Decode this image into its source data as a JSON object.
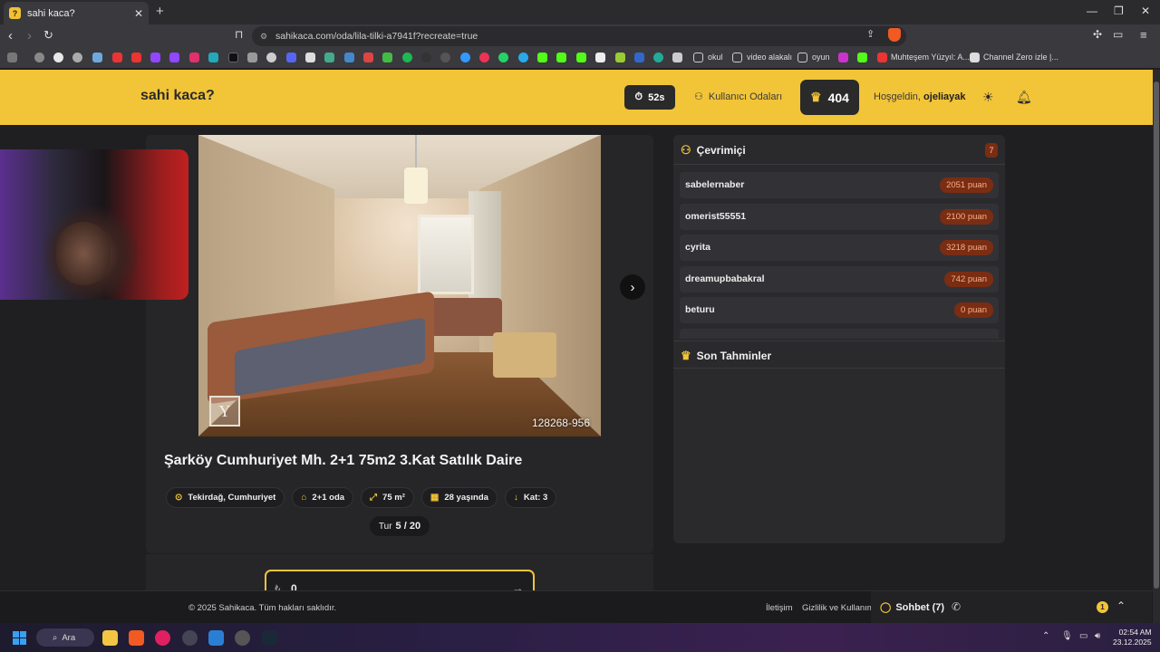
{
  "browser": {
    "tab_title": "sahi kaca?",
    "tab_favicon": "?",
    "url": "sahikaca.com/oda/lila-tilki-a7941f?recreate=true",
    "bookmarks": [
      "okul",
      "video alakalı",
      "oyun",
      "Muhteşem Yüzyıl: A...",
      "Channel Zero izle |..."
    ]
  },
  "header": {
    "brand": "sahi kaca?",
    "timer": "52s",
    "rooms_label": "Kullanıcı Odaları",
    "score": "404",
    "welcome_prefix": "Hoşgeldin,",
    "username": "ojeliayak"
  },
  "listing": {
    "photo_id": "128268-956",
    "watermark": "Y",
    "title": "Şarköy Cumhuriyet Mh. 2+1 75m2 3.Kat Satılık Daire",
    "chips": [
      {
        "icon": "location-icon",
        "glyph": "⊙",
        "label": "Tekirdağ, Cumhuriyet"
      },
      {
        "icon": "home-icon",
        "glyph": "⌂",
        "label": "2+1 oda"
      },
      {
        "icon": "area-icon",
        "glyph": "⤢",
        "label": "75 m²"
      },
      {
        "icon": "building-icon",
        "glyph": "▦",
        "label": "28 yaşında"
      },
      {
        "icon": "floor-icon",
        "glyph": "↓",
        "label": "Kat: 3"
      }
    ],
    "round_label": "Tur",
    "round_value": "5 / 20",
    "guess_currency": "₺",
    "guess_value": "0"
  },
  "sidebar": {
    "online_title": "Çevrimiçi",
    "online_count": "7",
    "users": [
      {
        "name": "sabelernaber",
        "points": "2051 puan"
      },
      {
        "name": "omerist55551",
        "points": "2100 puan"
      },
      {
        "name": "cyrita",
        "points": "3218 puan"
      },
      {
        "name": "dreamupbabakral",
        "points": "742 puan"
      },
      {
        "name": "beturu",
        "points": "0 puan"
      }
    ],
    "recent_title": "Son Tahminler"
  },
  "footer": {
    "copyright": "© 2025 Sahikaca. Tüm hakları saklıdır.",
    "contact": "İletişim",
    "privacy": "Gizlilik ve Kullanım",
    "chat_label": "Sohbet (7)",
    "chat_badge": "1"
  },
  "taskbar": {
    "search": "Ara",
    "time": "02:54 AM",
    "date": "23.12.2025"
  },
  "colors": {
    "accent": "#f2c438",
    "points_badge_bg": "#7a2d12",
    "panel_bg": "#262629"
  }
}
